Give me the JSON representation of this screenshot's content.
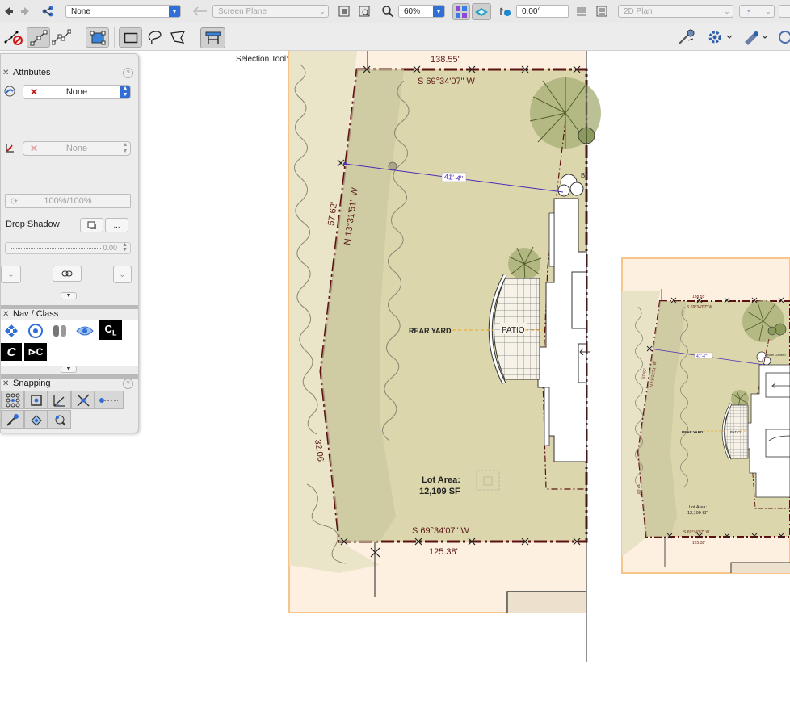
{
  "toolbar_top": {
    "class_select": "None",
    "plane_select": "Screen Plane",
    "zoom_value": "60%",
    "rotation_value": "0.00°",
    "view_select": "2D Plan"
  },
  "toolbar_modes": {
    "status_text": "Selection Tool: Rectangular Marquee Mode"
  },
  "attributes_palette": {
    "title": "Attributes",
    "fill_select": "None",
    "pen_select": "None",
    "opacity_value": "100%/100%",
    "drop_shadow_label": "Drop Shadow",
    "more_button": "...",
    "slider_value": "0.00"
  },
  "nav_class_palette": {
    "title": "Nav / Class"
  },
  "snapping_palette": {
    "title": "Snapping"
  },
  "drawing": {
    "main": {
      "dim_top": "138.55'",
      "bearing_top": "S 69°34'07\" W",
      "dim_left_upper": "57.62'",
      "bearing_left": "N 13°31'51\" W",
      "dim_diagonal": "41'-4\"",
      "rear_yard": "REAR YARD",
      "patio": "PATIO",
      "dim_left_lower": "32.06'",
      "lot_area_label": "Lot Area:",
      "lot_area_value": "12,109 SF",
      "bearing_bottom": "S 69°34'07\" W",
      "dim_bottom": "125.38'",
      "plant_label": "B"
    },
    "mini": {
      "dim_top": "138.55'",
      "bearing_top": "S 69°34'07\" W",
      "dim_diagonal": "41'-4\"",
      "plant_label": "Bath Garden",
      "dim_left": "57.62'",
      "bearing_left": "N 13°31'51\" W",
      "rear_yard": "REAR YARD",
      "patio": "PATIO",
      "dim_left_lower": "32.06'",
      "lot_area_label": "Lot Area:",
      "lot_area_value": "12,109 SF",
      "bearing_bottom": "S 69°34'07\" W",
      "dim_bottom": "125.38'"
    }
  },
  "colors": {
    "sheet": "#fdf0e0",
    "sheet_border": "#f7c58a",
    "lot_fill": "#dcd6ac",
    "lot_border": "#5c1212",
    "accent_blue": "#2f6fd6",
    "tree_green": "#8c9a5c"
  }
}
